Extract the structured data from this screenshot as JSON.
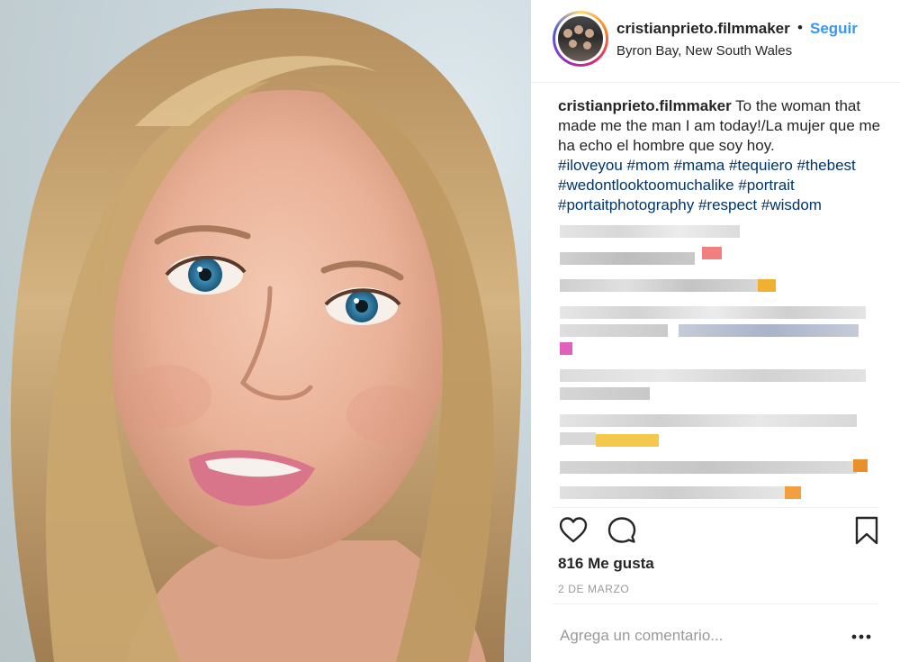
{
  "post": {
    "username": "cristianprieto.filmmaker",
    "separator": "•",
    "follow_label": "Seguir",
    "location": "Byron Bay, New South Wales"
  },
  "caption": {
    "username": "cristianprieto.filmmaker",
    "text": " To the woman that made me the man I am today!/La mujer que me ha echo el hombre que soy hoy.",
    "hashtags": "#iloveyou #mom #mama #tequiero #thebest #wedontlooktoomuchalike #portrait #portaitphotography #respect #wisdom"
  },
  "actions": {
    "like_icon": "heart-icon",
    "comment_icon": "speech-bubble-icon",
    "save_icon": "bookmark-icon"
  },
  "likes_text": "816 Me gusta",
  "date_text": "2 DE MARZO",
  "comment_input": {
    "placeholder": "Agrega un comentario...",
    "value": ""
  },
  "more_icon": "more-options-icon",
  "colors": {
    "link_blue": "#3897f0",
    "hashtag_blue": "#003569",
    "text": "#262626",
    "muted": "#999999",
    "divider": "#efefef"
  }
}
